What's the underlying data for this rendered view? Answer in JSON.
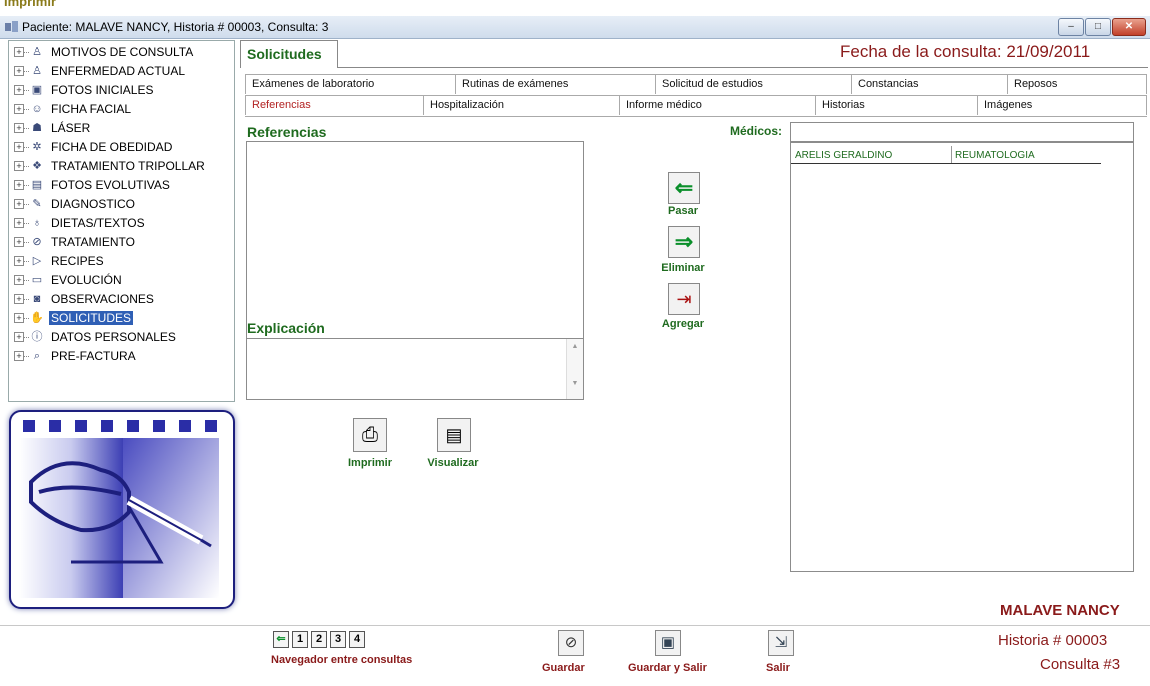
{
  "top_label": "Imprimir",
  "window": {
    "title": "Paciente: MALAVE  NANCY, Historia # 00003, Consulta: 3",
    "min": "–",
    "max": "□",
    "close": "✕"
  },
  "tree": {
    "items": [
      {
        "label": "MOTIVOS DE CONSULTA",
        "icon": "person-icon",
        "glyph": "♙"
      },
      {
        "label": "ENFERMEDAD ACTUAL",
        "icon": "person-icon",
        "glyph": "♙"
      },
      {
        "label": "FOTOS INICIALES",
        "icon": "photo-icon",
        "glyph": "▣"
      },
      {
        "label": "FICHA FACIAL",
        "icon": "face-icon",
        "glyph": "☺"
      },
      {
        "label": "LÁSER",
        "icon": "laser-icon",
        "glyph": "☗"
      },
      {
        "label": "FICHA DE OBEDIDAD",
        "icon": "gear-icon",
        "glyph": "✲"
      },
      {
        "label": "TRATAMIENTO TRIPOLLAR",
        "icon": "device-icon",
        "glyph": "❖"
      },
      {
        "label": "FOTOS EVOLUTIVAS",
        "icon": "photo-icon",
        "glyph": "▤"
      },
      {
        "label": "DIAGNOSTICO",
        "icon": "pencil-icon",
        "glyph": "✎"
      },
      {
        "label": "DIETAS/TEXTOS",
        "icon": "apple-icon",
        "glyph": "♁"
      },
      {
        "label": "TRATAMIENTO",
        "icon": "check-circle-icon",
        "glyph": "⊘"
      },
      {
        "label": "RECIPES",
        "icon": "document-icon",
        "glyph": "▷"
      },
      {
        "label": "EVOLUCIÓN",
        "icon": "document-icon",
        "glyph": "▭"
      },
      {
        "label": "OBSERVACIONES",
        "icon": "observations-icon",
        "glyph": "◙"
      },
      {
        "label": "SOLICITUDES",
        "icon": "hand-icon",
        "glyph": "✋"
      },
      {
        "label": "DATOS PERSONALES",
        "icon": "info-icon",
        "glyph": "ⓘ"
      },
      {
        "label": "PRE-FACTURA",
        "icon": "magnifier-icon",
        "glyph": "⌕"
      }
    ],
    "selected_index": 14
  },
  "main_tab": "Solicitudes",
  "fecha": "Fecha de la consulta:  21/09/2011",
  "subtabs_row1": [
    "Exámenes de laboratorio",
    "Rutinas de exámenes",
    "Solicitud de estudios",
    "Constancias",
    "Reposos"
  ],
  "subtabs_row2": [
    "Referencias",
    "Hospitalización",
    "Informe médico",
    "Historias",
    "Imágenes"
  ],
  "active_subtab": "Referencias",
  "referencias_label": "Referencias",
  "explicacion_label": "Explicación",
  "medicos_label": "Médicos:",
  "medicos_input_value": "",
  "doctors": [
    {
      "name": "ARELIS GERALDINO",
      "specialty": "REUMATOLOGIA"
    }
  ],
  "buttons": {
    "pasar": "Pasar",
    "eliminar": "Eliminar",
    "agregar": "Agregar",
    "imprimir": "Imprimir",
    "visualizar": "Visualizar",
    "guardar": "Guardar",
    "guardar_salir": "Guardar y Salir",
    "salir": "Salir"
  },
  "navigator": {
    "pages": [
      "1",
      "2",
      "3",
      "4"
    ],
    "label": "Navegador entre consultas"
  },
  "patient": {
    "name": "MALAVE  NANCY",
    "historia": "Historia # 00003",
    "consulta": "Consulta #3"
  },
  "colors": {
    "green_label": "#1f6b1f",
    "dark_red": "#8a1a1a",
    "selection_blue": "#2f5fb5",
    "logo_navy": "#1d1f7e"
  }
}
